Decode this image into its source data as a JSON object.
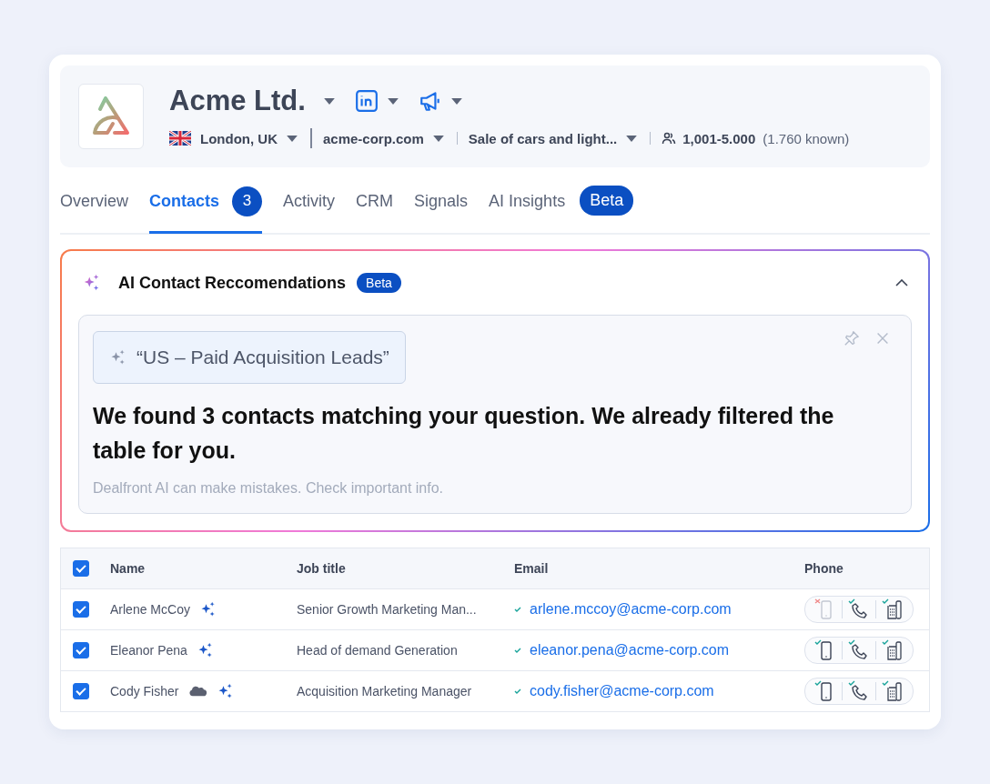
{
  "company": {
    "name": "Acme Ltd.",
    "location": "London, UK",
    "domain": "acme-corp.com",
    "industry": "Sale of cars and light...",
    "employees": "1,001-5.000",
    "employees_known": "(1.760 known)"
  },
  "tabs": [
    {
      "label": "Overview",
      "selected": false
    },
    {
      "label": "Contacts",
      "selected": true,
      "count": "3"
    },
    {
      "label": "Activity",
      "selected": false
    },
    {
      "label": "CRM",
      "selected": false
    },
    {
      "label": "Signals",
      "selected": false
    },
    {
      "label": "AI Insights",
      "selected": false,
      "badge": "Beta"
    }
  ],
  "ai_panel": {
    "title": "AI Contact Reccomendations",
    "badge": "Beta",
    "expanded": true,
    "query": "“US – Paid Acquisition Leads”",
    "message": "We found 3 contacts matching your question. We already filtered the table for you.",
    "disclaimer": "Dealfront AI can make mistakes. Check important info."
  },
  "table": {
    "all_checked": true,
    "columns": [
      "Name",
      "Job title",
      "Email",
      "Phone"
    ],
    "rows": [
      {
        "selected": true,
        "name": "Arlene McCoy",
        "crm_synced": false,
        "job_title": "Senior Growth Marketing Man...",
        "email": "arlene.mccoy@acme-corp.com",
        "email_verified": true,
        "mobile": false,
        "landline": true,
        "office": true
      },
      {
        "selected": true,
        "name": "Eleanor Pena",
        "crm_synced": false,
        "job_title": "Head of demand Generation",
        "email": "eleanor.pena@acme-corp.com",
        "email_verified": true,
        "mobile": true,
        "landline": true,
        "office": true
      },
      {
        "selected": true,
        "name": "Cody Fisher",
        "crm_synced": true,
        "job_title": "Acquisition Marketing Manager",
        "email": "cody.fisher@acme-corp.com",
        "email_verified": true,
        "mobile": true,
        "landline": true,
        "office": true
      }
    ]
  }
}
